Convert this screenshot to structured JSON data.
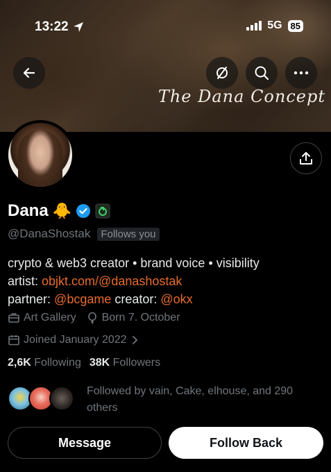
{
  "status_bar": {
    "time": "13:22",
    "network": "5G",
    "battery": "85"
  },
  "banner": {
    "script_title": "The Dana Concept"
  },
  "header_actions": {
    "back": "arrow-left-icon",
    "hide": "circle-slash-icon",
    "search": "search-icon",
    "more": "more-horizontal-icon"
  },
  "profile": {
    "name": "Dana",
    "name_emoji": "🐥",
    "handle": "@DanaShostak",
    "follows_you": "Follows you",
    "bio": {
      "line1": "crypto & web3 creator • brand voice • visibility",
      "line2_prefix": "artist: ",
      "line2_link": "objkt.com/@danashostak",
      "line3_prefix": "partner: ",
      "line3_link1": "@bcgame",
      "line3_middle": " creator: ",
      "line3_link2": "@okx"
    },
    "category": "Art Gallery",
    "born": "Born 7. October",
    "joined": "Joined January 2022",
    "following_count": "2,6K",
    "following_label": "Following",
    "followers_count": "38K",
    "followers_label": "Followers",
    "followed_by": "Followed by vain, Cake, elhouse, and 290 others"
  },
  "buttons": {
    "message": "Message",
    "follow_back": "Follow Back"
  },
  "colors": {
    "link": "#e76b2c",
    "verified": "#1d9bf0",
    "background": "#000000"
  }
}
